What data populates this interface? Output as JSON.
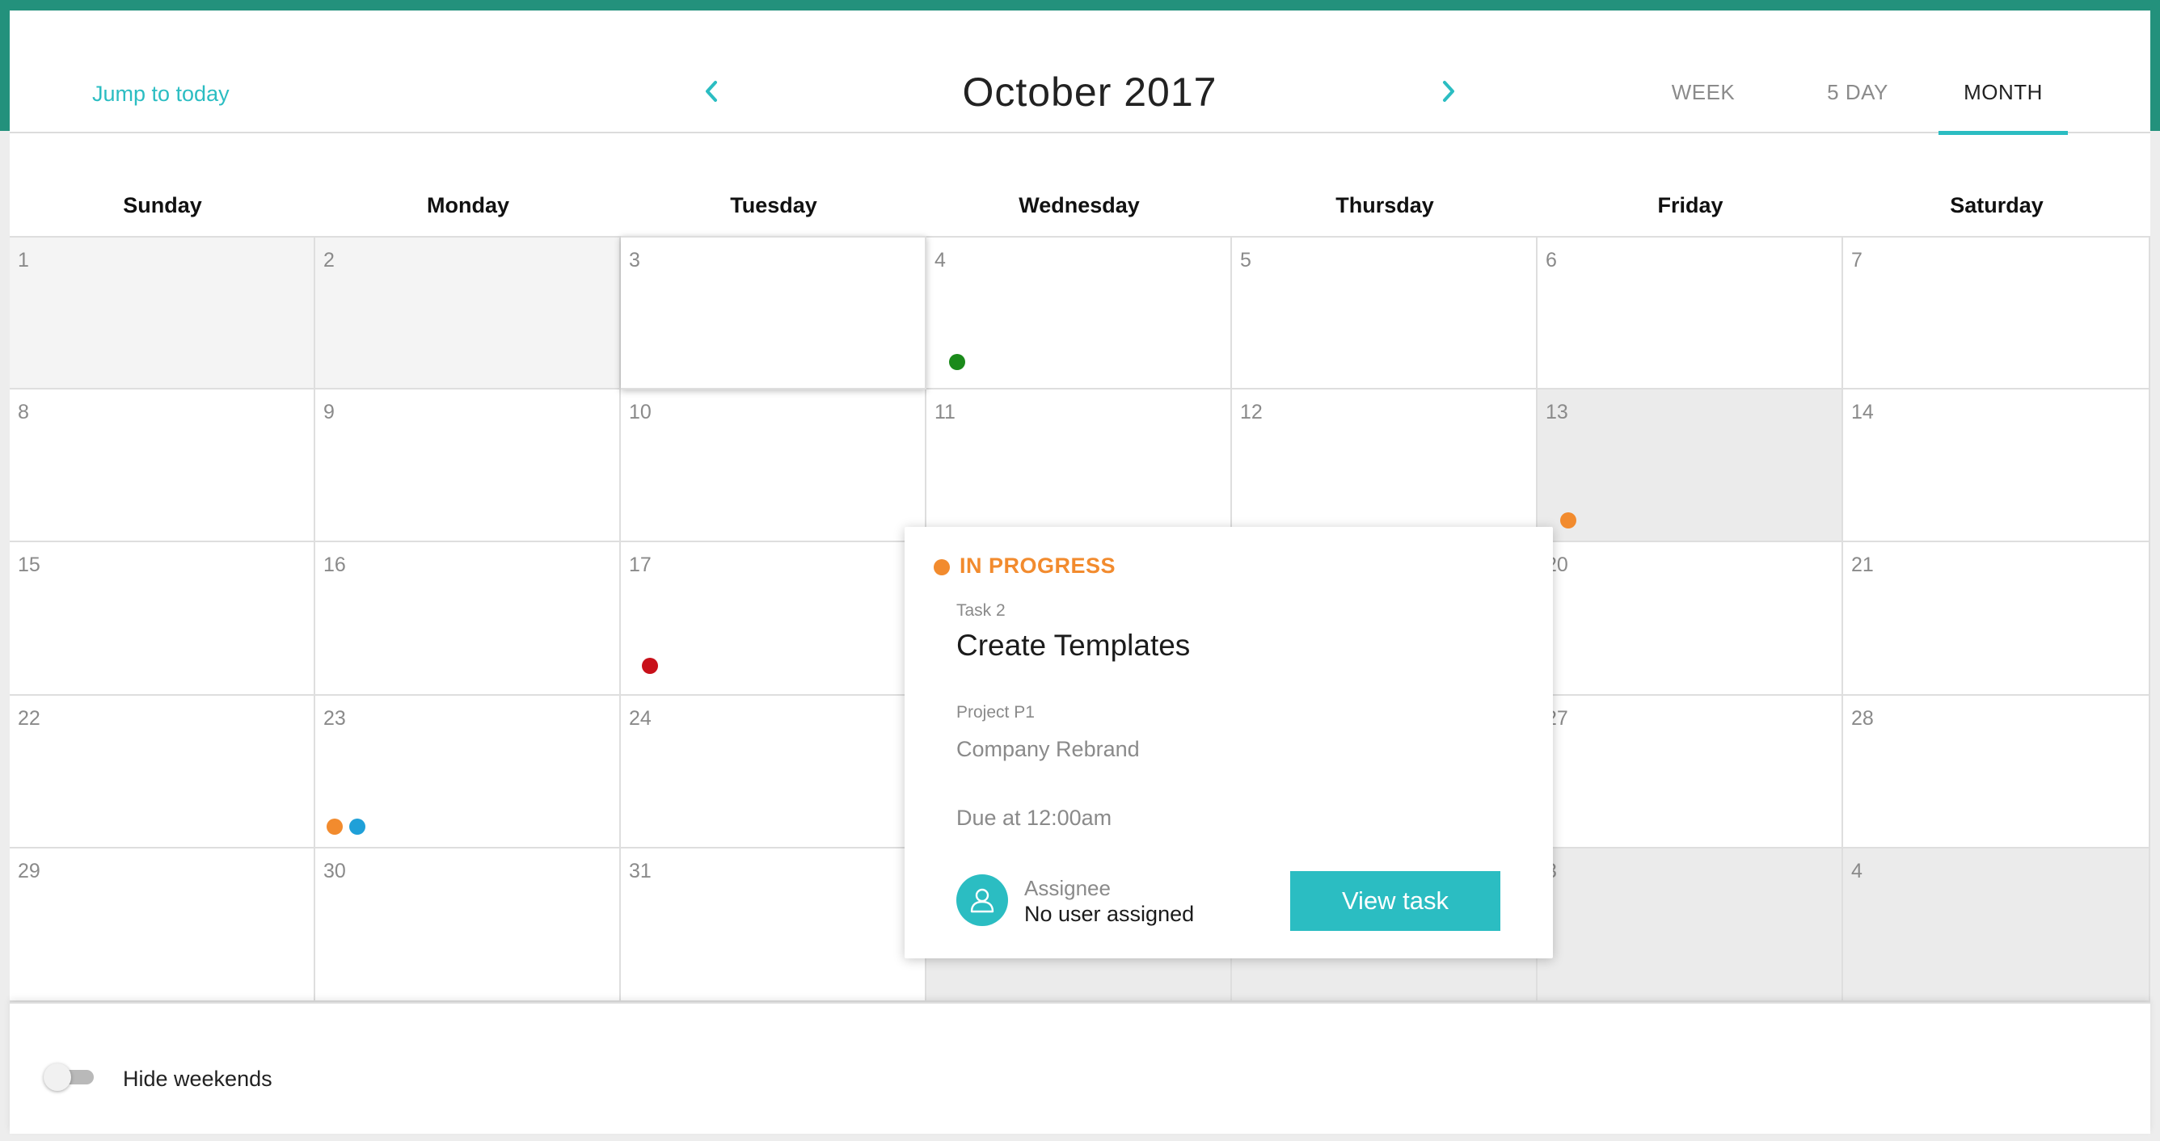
{
  "header": {
    "jump_today": "Jump to today",
    "month_title": "October 2017",
    "views": [
      "WEEK",
      "5 DAY",
      "MONTH"
    ],
    "active_view": "MONTH"
  },
  "weekdays": [
    "Sunday",
    "Monday",
    "Tuesday",
    "Wednesday",
    "Thursday",
    "Friday",
    "Saturday"
  ],
  "calendar": {
    "weeks": [
      [
        "1",
        "2",
        "3",
        "4",
        "5",
        "6",
        "7"
      ],
      [
        "8",
        "9",
        "10",
        "11",
        "12",
        "13",
        "14"
      ],
      [
        "15",
        "16",
        "17",
        "",
        "",
        "20",
        "21"
      ],
      [
        "22",
        "23",
        "24",
        "",
        "",
        "27",
        "28"
      ],
      [
        "29",
        "30",
        "31",
        "",
        "",
        "3",
        "4"
      ]
    ]
  },
  "popup": {
    "status": "IN PROGRESS",
    "task_label": "Task 2",
    "task_title": "Create Templates",
    "project_label": "Project P1",
    "project_name": "Company Rebrand",
    "due": "Due at 12:00am",
    "assignee_label": "Assignee",
    "assignee_value": "No user assigned",
    "button": "View task"
  },
  "footer": {
    "toggle_label": "Hide weekends",
    "toggle_on": false
  },
  "colors": {
    "accent": "#2bbdc2",
    "brand_bar": "#23917c",
    "in_progress": "#f28b2e",
    "green": "#1a8a1a",
    "red": "#c8101a",
    "blue": "#1fa0d8"
  }
}
